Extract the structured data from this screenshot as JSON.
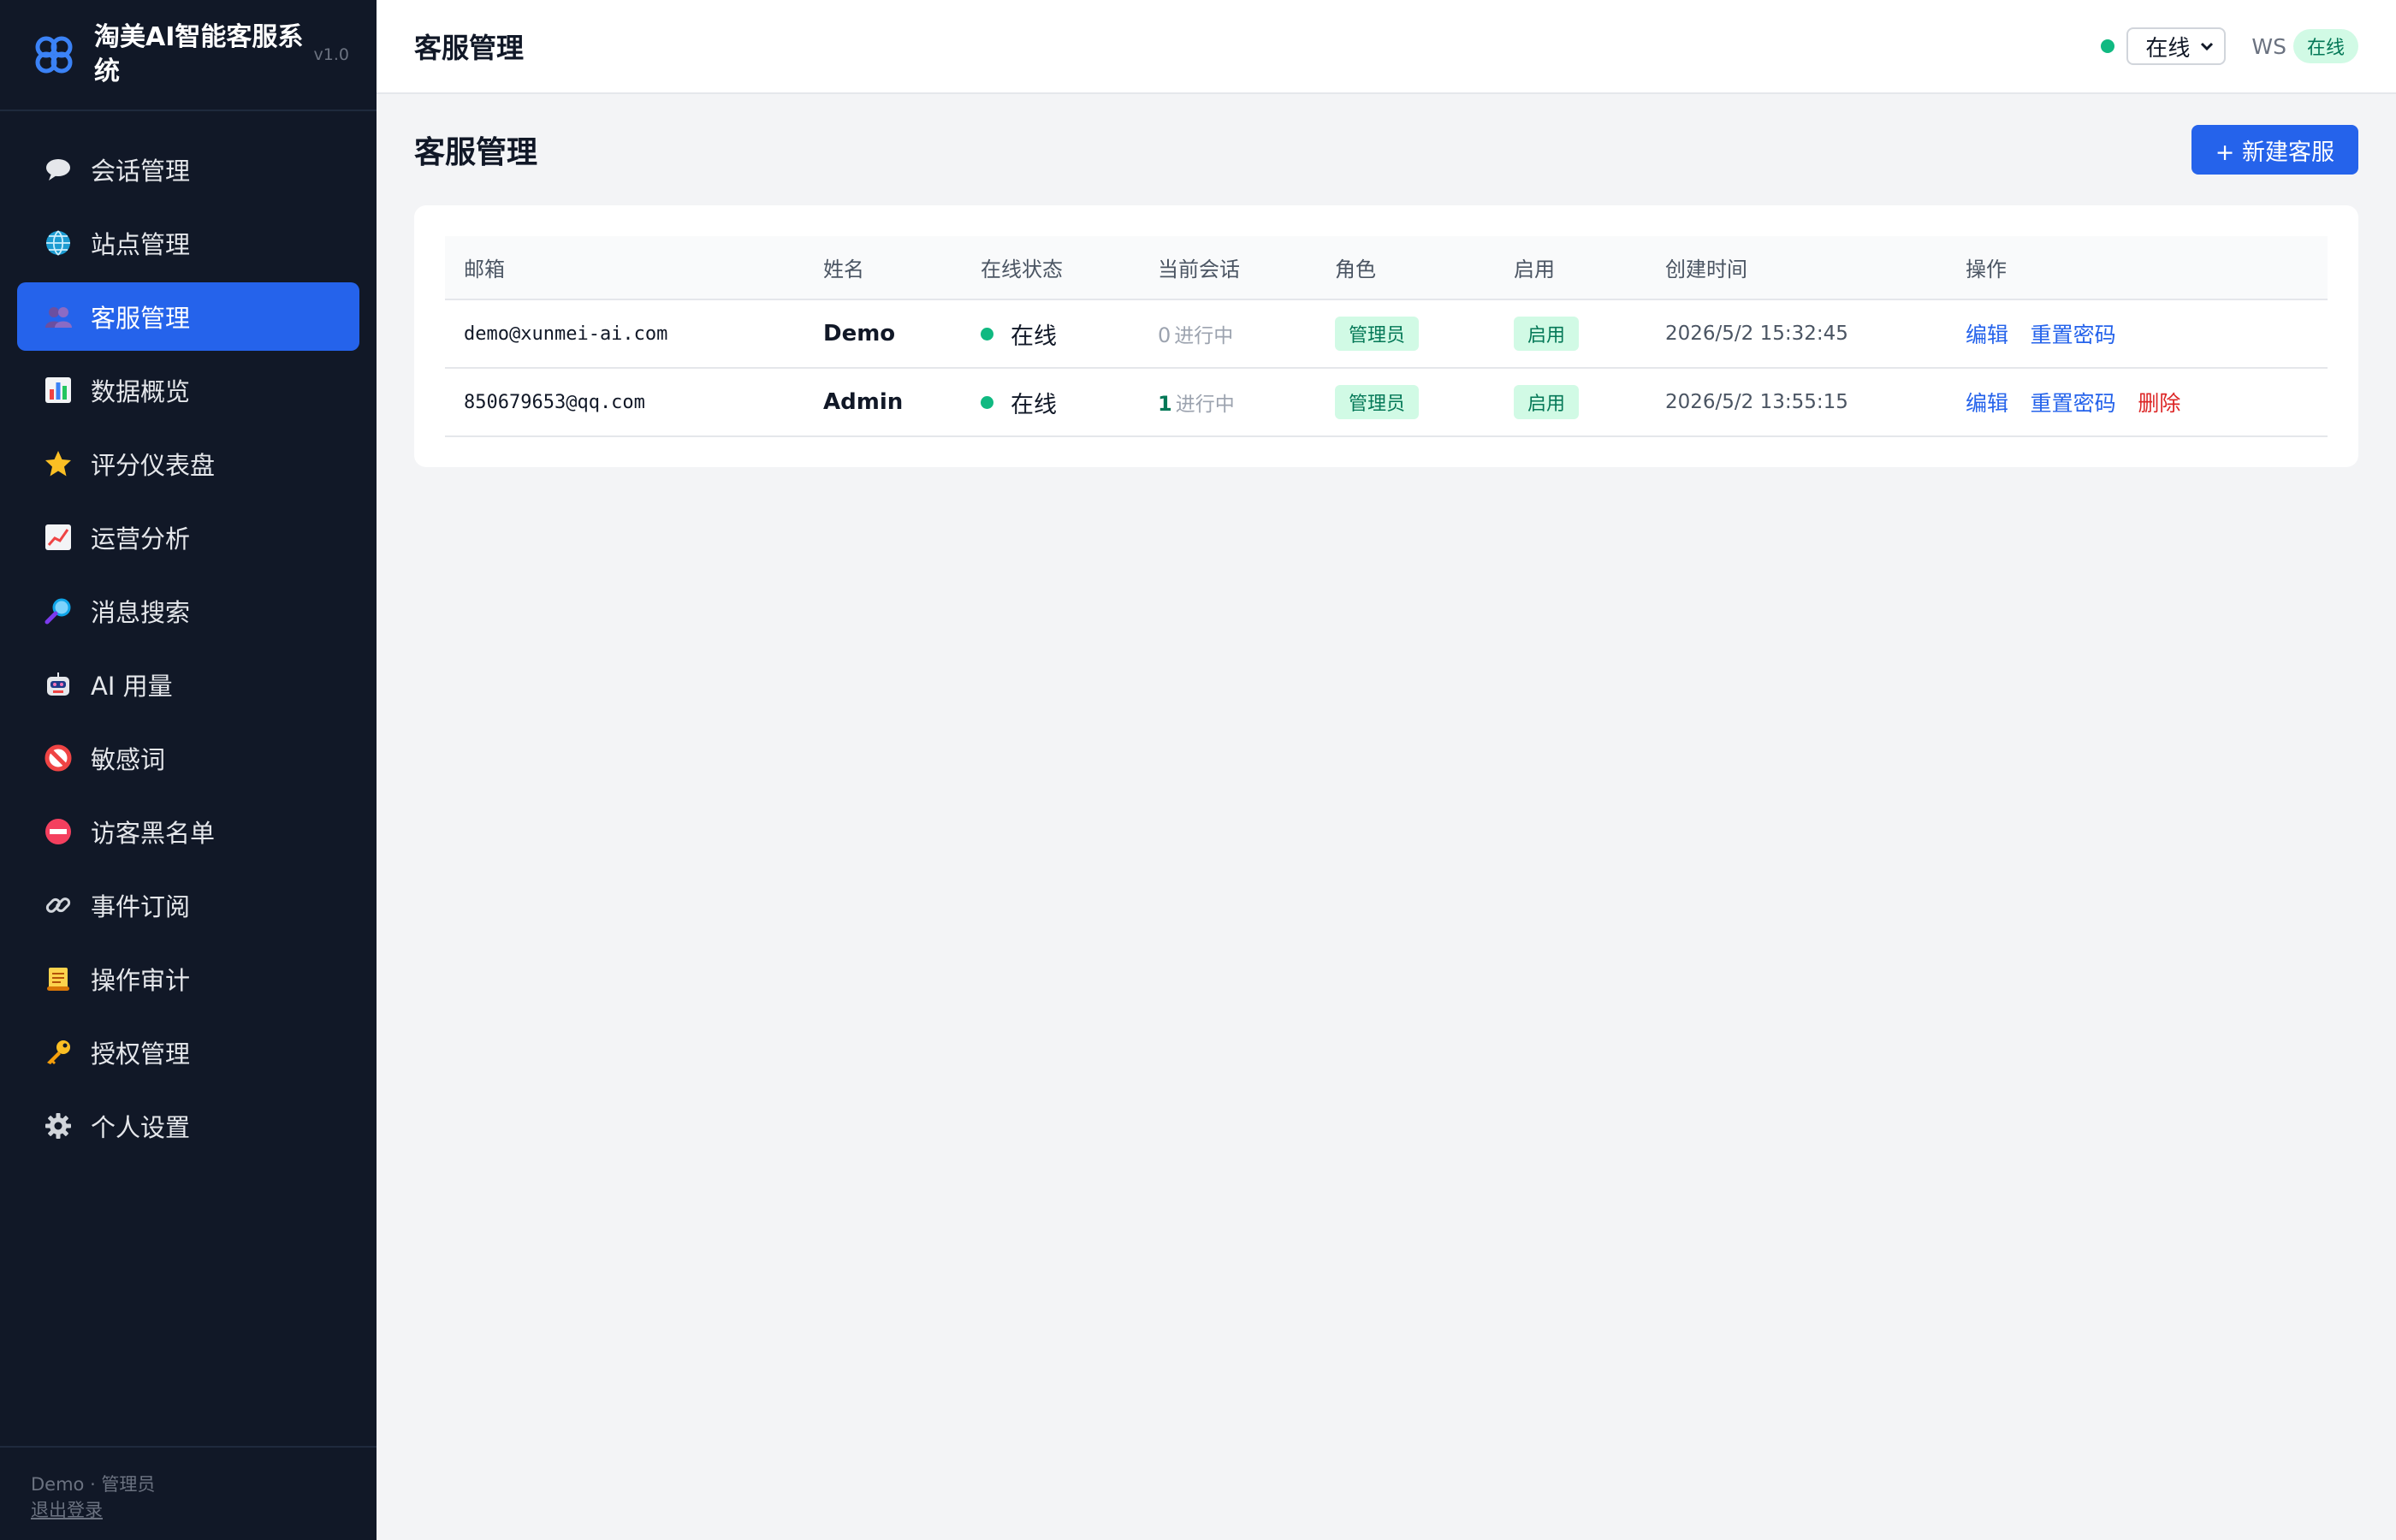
{
  "app": {
    "title": "淘美AI智能客服系统",
    "version": "v1.0"
  },
  "sidebar": {
    "items": [
      {
        "label": "会话管理",
        "icon": "speech-bubble-icon",
        "active": false
      },
      {
        "label": "站点管理",
        "icon": "globe-icon",
        "active": false
      },
      {
        "label": "客服管理",
        "icon": "users-icon",
        "active": true
      },
      {
        "label": "数据概览",
        "icon": "bar-chart-icon",
        "active": false
      },
      {
        "label": "评分仪表盘",
        "icon": "star-icon",
        "active": false
      },
      {
        "label": "运营分析",
        "icon": "line-chart-icon",
        "active": false
      },
      {
        "label": "消息搜索",
        "icon": "magnifier-icon",
        "active": false
      },
      {
        "label": "AI 用量",
        "icon": "robot-icon",
        "active": false
      },
      {
        "label": "敏感词",
        "icon": "prohibited-icon",
        "active": false
      },
      {
        "label": "访客黑名单",
        "icon": "no-entry-icon",
        "active": false
      },
      {
        "label": "事件订阅",
        "icon": "link-icon",
        "active": false
      },
      {
        "label": "操作审计",
        "icon": "scroll-icon",
        "active": false
      },
      {
        "label": "授权管理",
        "icon": "key-icon",
        "active": false
      },
      {
        "label": "个人设置",
        "icon": "gear-icon",
        "active": false
      }
    ],
    "footer": {
      "user": "Demo · 管理员",
      "logout": "退出登录"
    }
  },
  "topbar": {
    "title": "客服管理",
    "status_value": "在线",
    "ws_label": "WS",
    "ws_status": "在线"
  },
  "page": {
    "title": "客服管理",
    "new_button": "+ 新建客服"
  },
  "table": {
    "columns": [
      "邮箱",
      "姓名",
      "在线状态",
      "当前会话",
      "角色",
      "启用",
      "创建时间",
      "操作"
    ],
    "rows": [
      {
        "email": "demo@xunmei-ai.com",
        "name": "Demo",
        "status": "在线",
        "sessions": "0",
        "sessions_label": "进行中",
        "role": "管理员",
        "enabled": "启用",
        "created": "2026/5/2 15:32:45",
        "actions": [
          "编辑",
          "重置密码"
        ]
      },
      {
        "email": "850679653@qq.com",
        "name": "Admin",
        "status": "在线",
        "sessions": "1",
        "sessions_label": "进行中",
        "role": "管理员",
        "enabled": "启用",
        "created": "2026/5/2 13:55:15",
        "actions": [
          "编辑",
          "重置密码",
          "删除"
        ]
      }
    ]
  },
  "colors": {
    "sidebar_bg": "#111827",
    "accent": "#2563eb",
    "online": "#10b981",
    "danger": "#dc2626"
  }
}
